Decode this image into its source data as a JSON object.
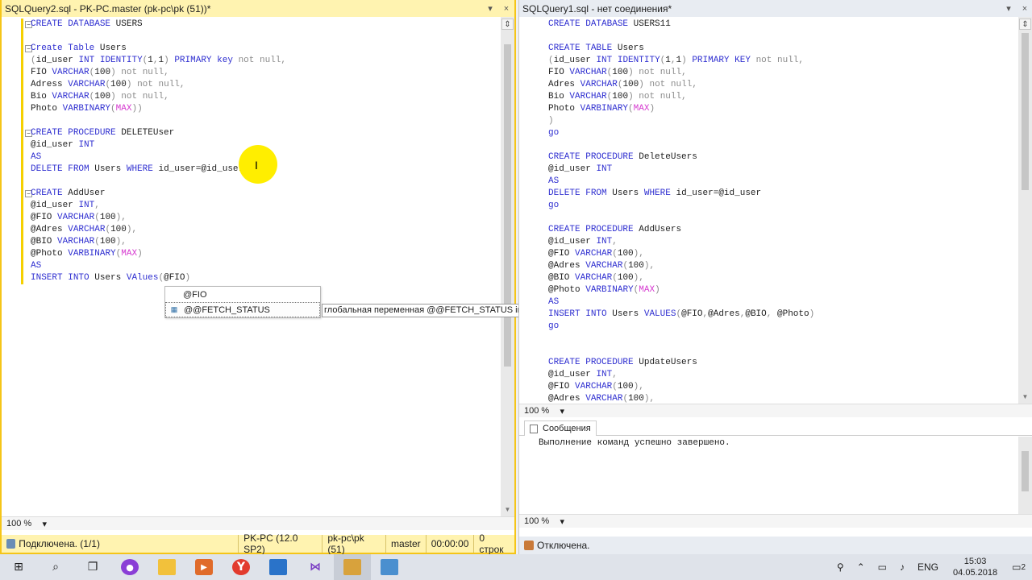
{
  "left": {
    "tab_title": "SQLQuery2.sql - PK-PC.master (pk-pc\\pk (51))*",
    "pin_icon": "pin-icon",
    "close_glyph": "×",
    "zoom": "100 %",
    "status": {
      "connection": "Подключена. (1/1)",
      "server": "PK-PC (12.0 SP2)",
      "user": "pk-pc\\pk (51)",
      "database": "master",
      "time": "00:00:00",
      "rows": "0 строк"
    },
    "code": [
      "CREATE DATABASE USERS",
      "",
      "Create Table Users",
      "(id_user INT IDENTITY(1,1) PRIMARY key not null,",
      "FIO VARCHAR(100) not null,",
      "Adress VARCHAR(100) not null,",
      "Bio VARCHAR(100) not null,",
      "Photo VARBINARY(MAX))",
      "",
      "CREATE PROCEDURE DELETEUser",
      "@id_user INT",
      "AS",
      "DELETE FROM Users WHERE id_user=@id_user",
      "",
      "CREATE AddUser",
      "@id_user INT,",
      "@FIO VARCHAR(100),",
      "@Adres VARCHAR(100),",
      "@BIO VARCHAR(100),",
      "@Photo VARBINARY(MAX)",
      "AS",
      "INSERT INTO Users VAlues(@FIO)"
    ],
    "autocomplete": [
      "@FIO",
      "@@FETCH_STATUS"
    ],
    "tooltip": "глобальная переменная @@FETCH_STATUS int"
  },
  "right": {
    "tab_title": "SQLQuery1.sql - нет соединения*",
    "zoom_editor": "100 %",
    "zoom_messages": "100 %",
    "messages_tab": "Сообщения",
    "message": "Выполнение команд успешно завершено.",
    "status": "Отключена.",
    "code": [
      "CREATE DATABASE USERS11",
      "",
      "CREATE TABLE Users",
      "(id_user INT IDENTITY(1,1) PRIMARY KEY not null,",
      "FIO VARCHAR(100) not null,",
      "Adres VARCHAR(100) not null,",
      "Bio VARCHAR(100) not null,",
      "Photo VARBINARY(MAX)",
      ")",
      "go",
      "",
      "CREATE PROCEDURE DeleteUsers",
      "@id_user INT",
      "AS",
      "DELETE FROM Users WHERE id_user=@id_user",
      "go",
      "",
      "CREATE PROCEDURE AddUsers",
      "@id_user INT,",
      "@FIO VARCHAR(100),",
      "@Adres VARCHAR(100),",
      "@BIO VARCHAR(100),",
      "@Photo VARBINARY(MAX)",
      "AS",
      "INSERT INTO Users VALUES(@FIO,@Adres,@BIO, @Photo)",
      "go",
      "",
      "",
      "CREATE PROCEDURE UpdateUsers",
      "@id_user INT,",
      "@FIO VARCHAR(100),",
      "@Adres VARCHAR(100),"
    ]
  },
  "taskbar": {
    "language": "ENG",
    "time": "15:03",
    "date": "04.05.2018",
    "notifications": "2",
    "icons": [
      "windows-start-icon",
      "search-icon",
      "task-view-icon",
      "cortana-mic-icon",
      "file-explorer-icon",
      "media-player-icon",
      "yandex-browser-icon",
      "app-icon",
      "visual-studio-icon",
      "sql-tools-icon",
      "ssms-icon"
    ]
  },
  "colors": {
    "keyword": "#2f2fd0",
    "comment_gray": "#8a8a8a",
    "function_pink": "#d63bd0",
    "active_tab": "#fff3b0",
    "highlight": "#ffee00"
  }
}
